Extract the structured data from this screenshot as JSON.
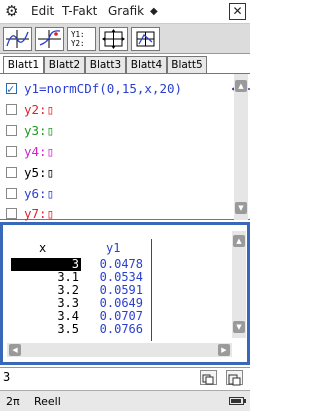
{
  "menu": {
    "edit": "Edit",
    "tfakt": "T-Fakt",
    "grafik": "Grafik",
    "diamond": "◆"
  },
  "toolbar": {
    "btn3_text_top": "Y1:",
    "btn3_text_bottom": "Y2:"
  },
  "tabs": [
    "Blatt1",
    "Blatt2",
    "Blatt3",
    "Blatt4",
    "Blatt5"
  ],
  "functions": [
    {
      "label": "y1=normCDf(0,15,x,20)",
      "color": "#2a3fcf",
      "checked": true,
      "line_style": "solid"
    },
    {
      "label": "y2:▯",
      "color": "#e0202a",
      "checked": false
    },
    {
      "label": "y3:▯",
      "color": "#1a9a1a",
      "checked": false
    },
    {
      "label": "y4:▯",
      "color": "#d020d0",
      "checked": false
    },
    {
      "label": "y5:▯",
      "color": "#000000",
      "checked": false
    },
    {
      "label": "y6:▯",
      "color": "#2a3fcf",
      "checked": false
    },
    {
      "label": "y7:▯",
      "color": "#e0202a",
      "checked": false
    }
  ],
  "table": {
    "headers": {
      "x": "x",
      "y1": "y1"
    },
    "rows": [
      {
        "x": "3",
        "y1": "0.0478"
      },
      {
        "x": "3.1",
        "y1": "0.0534"
      },
      {
        "x": "3.2",
        "y1": "0.0591"
      },
      {
        "x": "3.3",
        "y1": "0.0649"
      },
      {
        "x": "3.4",
        "y1": "0.0707"
      },
      {
        "x": "3.5",
        "y1": "0.0766"
      }
    ]
  },
  "input": {
    "value": "3"
  },
  "status": {
    "angle": "2π",
    "mode": "Reell"
  }
}
